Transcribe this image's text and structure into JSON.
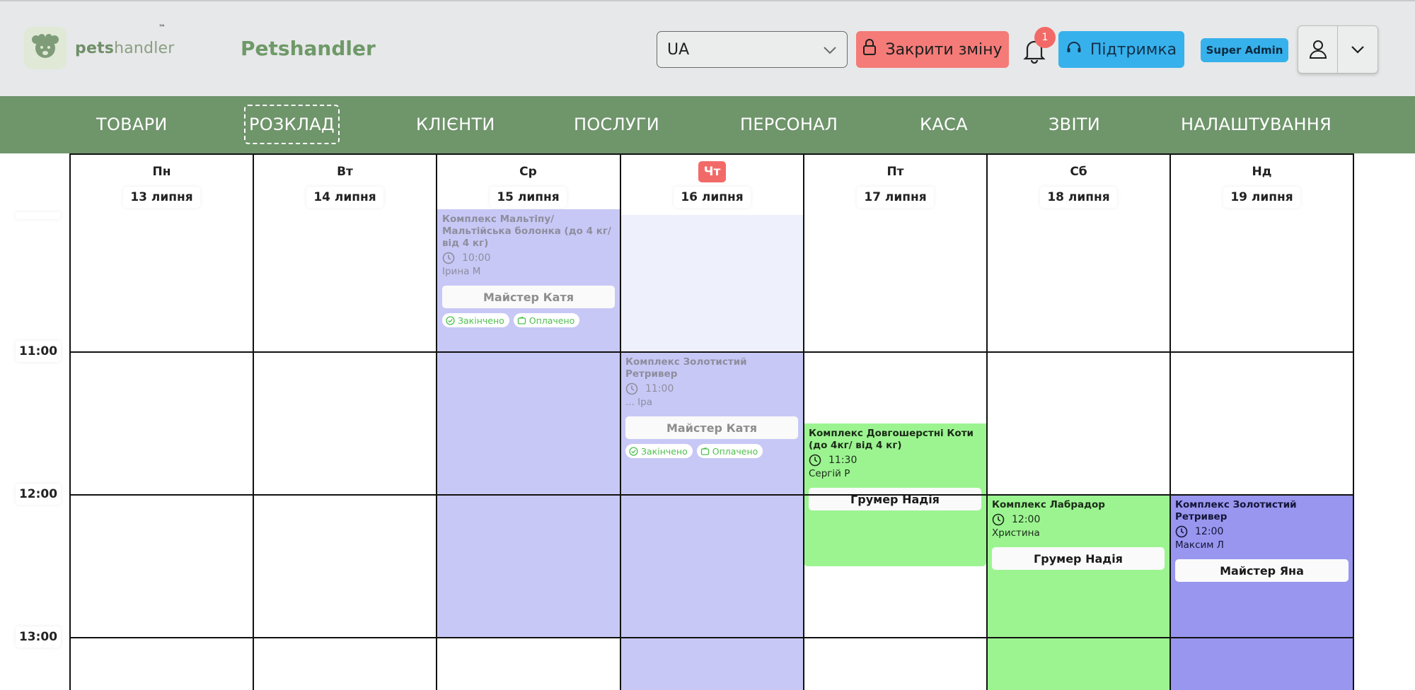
{
  "header": {
    "logo_text_bold": "pets",
    "logo_text_light": "handler",
    "logo_tm": "™",
    "brand": "Petshandler",
    "language": "UA",
    "close_shift_label": "Закрити зміну",
    "notifications_count": "1",
    "support_label": "Підтримка",
    "role": "Super Admin"
  },
  "nav": {
    "items": [
      {
        "label": "ТОВАРИ"
      },
      {
        "label": "РОЗКЛАД",
        "active": true
      },
      {
        "label": "КЛІЄНТИ"
      },
      {
        "label": "ПОСЛУГИ"
      },
      {
        "label": "ПЕРСОНАЛ"
      },
      {
        "label": "КАСА"
      },
      {
        "label": "ЗВІТИ"
      },
      {
        "label": "НАЛАШТУВАННЯ"
      }
    ]
  },
  "calendar": {
    "days": [
      {
        "name": "Пн",
        "date": "13 липня"
      },
      {
        "name": "Вт",
        "date": "14 липня"
      },
      {
        "name": "Ср",
        "date": "15 липня"
      },
      {
        "name": "Чт",
        "date": "16 липня",
        "today": true
      },
      {
        "name": "Пт",
        "date": "17 липня"
      },
      {
        "name": "Сб",
        "date": "18 липня"
      },
      {
        "name": "Нд",
        "date": "19 липня"
      }
    ],
    "times": [
      "11:00",
      "12:00",
      "13:00"
    ],
    "appointments": [
      {
        "title": "Комплекс Мальтіпу/Мальтійська болонка (до 4 кг/від 4 кг)",
        "time": "10:00",
        "client": "Ірина М",
        "staff": "Майстер Катя",
        "tags": [
          "Закінчено",
          "Оплачено"
        ],
        "status": "done"
      },
      {
        "title": "Комплекс Золотистий Ретривер",
        "time": "11:00",
        "client": "... Іра",
        "staff": "Майстер Катя",
        "tags": [
          "Закінчено",
          "Оплачено"
        ],
        "status": "done"
      },
      {
        "title": "Комплекс Довгошерстні Коти (до 4кг/ від 4 кг)",
        "time": "11:30",
        "client": "Сергій Р",
        "staff": "Грумер Надія",
        "status": "green"
      },
      {
        "title": "Комплекс Лабрадор",
        "time": "12:00",
        "client": "Христина",
        "staff": "Грумер Надія",
        "status": "green"
      },
      {
        "title": "Комплекс Золотистий Ретривер",
        "time": "12:00",
        "client": "Максим Л",
        "staff": "Майстер Яна",
        "status": "purple"
      }
    ]
  },
  "colors": {
    "nav_green": "#6f956b",
    "close_shift_red": "#f47b78",
    "support_blue": "#37b1ec",
    "done_appt": "#c8c8f6",
    "green_appt": "#9cf491",
    "purple_appt": "#9896ee",
    "today_red": "#f26a67"
  }
}
